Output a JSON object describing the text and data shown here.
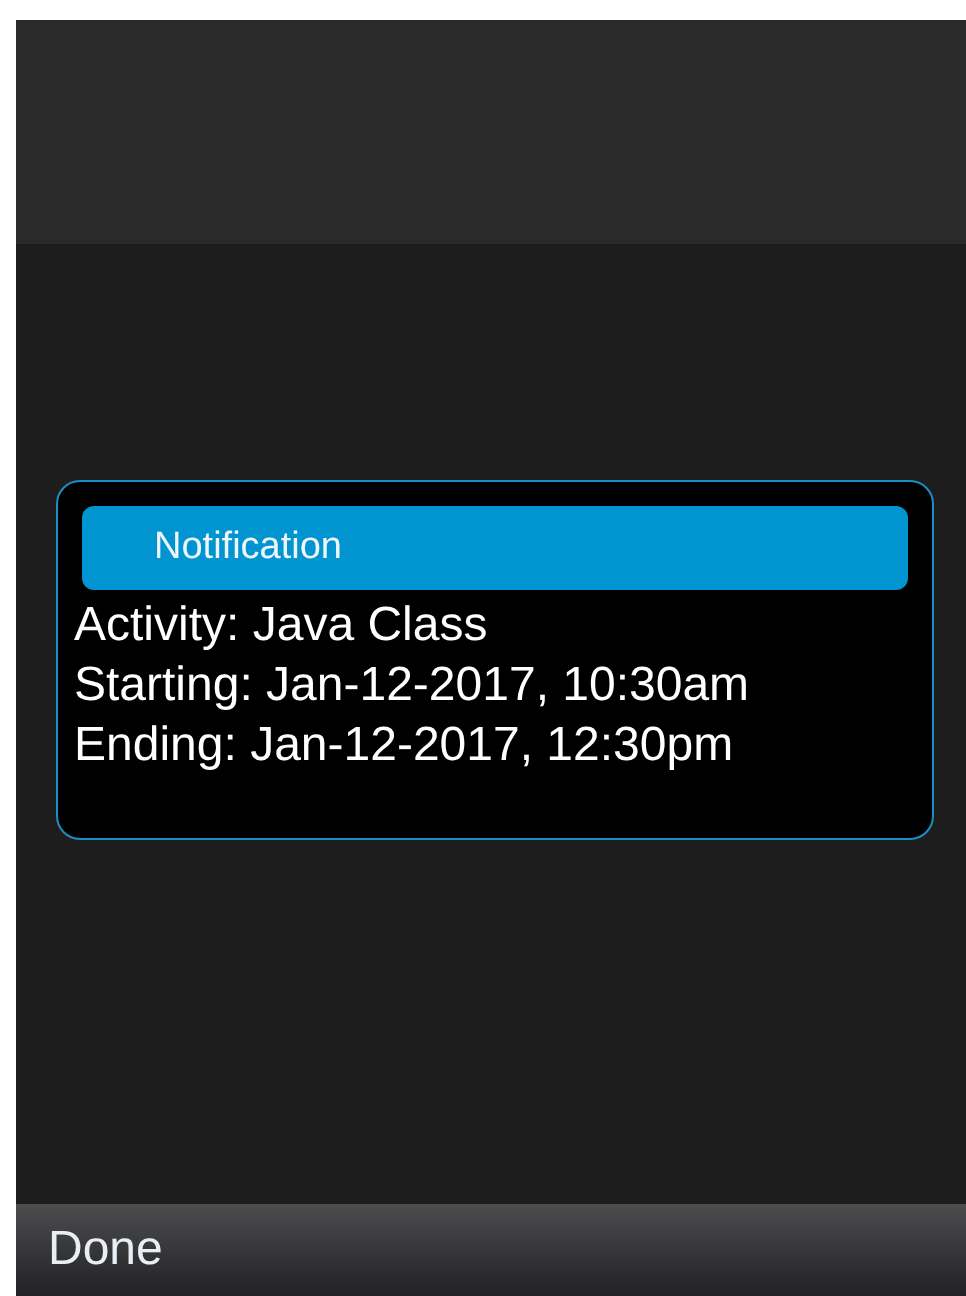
{
  "dialog": {
    "title": "Notification",
    "lines": [
      "Activity: Java Class",
      "Starting: Jan-12-2017, 10:30am",
      "Ending: Jan-12-2017, 12:30pm"
    ]
  },
  "softkeys": {
    "left": "Done"
  }
}
